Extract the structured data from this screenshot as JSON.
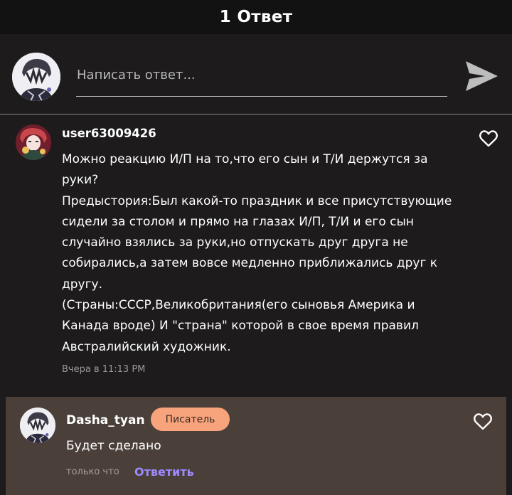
{
  "header": {
    "title": "1 Ответ"
  },
  "reply_bar": {
    "placeholder": "Написать ответ..."
  },
  "comment": {
    "username": "user63009426",
    "text": "Можно реакцию И/П на то,что его сын и Т/И держутся за\nруки?\nПредыстория:Был какой-то праздник и все присутствующие\nсидели за столом и прямо на глазах И/П, Т/И и его сын\nслучайно взялись за руки,но отпускать друг друга не\nсобирались,а затем вовсе медленно приближались друг к\nдругу.\n(Страны:СССР,Великобритания(его сыновья Америка и\nКанада вроде) И \"страна\" которой в свое время правил\nАвстралийский художник.",
    "timestamp": "Вчера в 11:13 PM"
  },
  "reply": {
    "username": "Dasha_tyan",
    "badge": "Писатель",
    "text": "Будет сделано",
    "timestamp": "только что",
    "answer_label": "Ответить"
  },
  "colors": {
    "background": "#1d1b1c",
    "header": "#121212",
    "reply_background": "#4a3f39",
    "badge": "#f7a37b",
    "link": "#9d8bff"
  },
  "icons": [
    "send-icon",
    "heart-icon",
    "avatar"
  ]
}
